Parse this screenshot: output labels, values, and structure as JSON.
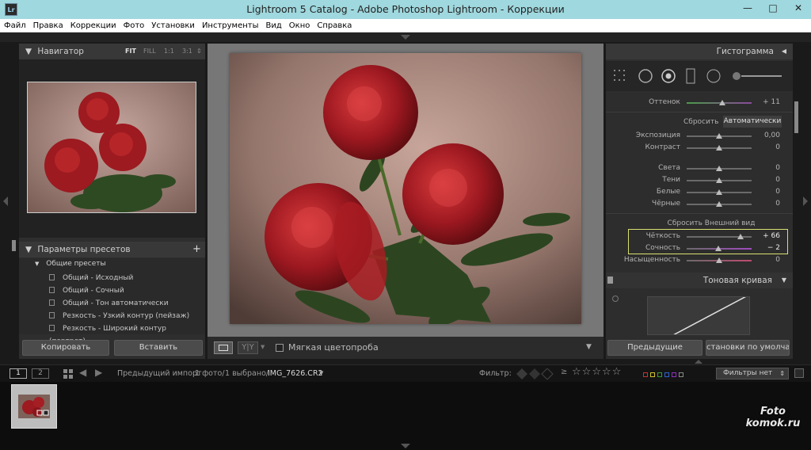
{
  "window": {
    "title": "Lightroom 5 Catalog - Adobe Photoshop Lightroom - Коррекции",
    "app_icon_text": "Lr",
    "minimize": "—",
    "maximize": "□",
    "close": "✕"
  },
  "menu": [
    "Файл",
    "Правка",
    "Коррекции",
    "Фото",
    "Установки",
    "Инструменты",
    "Вид",
    "Окно",
    "Справка"
  ],
  "navigator": {
    "title": "Навигатор",
    "zoom_options": [
      "FIT",
      "FILL",
      "1:1",
      "3:1"
    ]
  },
  "presets": {
    "title": "Параметры пресетов",
    "add_label": "+",
    "group": "Общие пресеты",
    "items": [
      "Общий - Исходный",
      "Общий - Сочный",
      "Общий - Тон автоматически",
      "Резкость - Узкий контур (пейзаж)",
      "Резкость - Широкий контур (портрет)"
    ]
  },
  "left_buttons": {
    "copy": "Копировать",
    "paste": "Вставить"
  },
  "center_toolbar": {
    "soft_proof_label": "Мягкая цветопроба",
    "view_yy": "Y|Y"
  },
  "right_panel": {
    "histogram_title": "Гистограмма",
    "tint": {
      "label": "Оттенок",
      "value": "+ 11",
      "position": 0.55
    },
    "tone_reset": "Сбросить",
    "tone_auto": "Автоматически",
    "tone_sliders": [
      {
        "label": "Экспозиция",
        "value": "0,00",
        "position": 0.5
      },
      {
        "label": "Контраст",
        "value": "0",
        "position": 0.5
      }
    ],
    "light_sliders": [
      {
        "label": "Света",
        "value": "0",
        "position": 0.5
      },
      {
        "label": "Тени",
        "value": "0",
        "position": 0.5
      },
      {
        "label": "Белые",
        "value": "0",
        "position": 0.5
      },
      {
        "label": "Чёрные",
        "value": "0",
        "position": 0.5
      }
    ],
    "presence_reset": "Сбросить Внешний вид",
    "presence_sliders": [
      {
        "label": "Чёткость",
        "value": "+ 66",
        "position": 0.83,
        "highlight": true
      },
      {
        "label": "Сочность",
        "value": "− 2",
        "position": 0.49,
        "highlight": true
      },
      {
        "label": "Насыщенность",
        "value": "0",
        "position": 0.5,
        "highlight": false
      }
    ],
    "tone_curve_title": "Тоновая кривая",
    "previous_button": "Предыдущие",
    "defaults_button": "становки по умолчанию..."
  },
  "filmstrip": {
    "page1": "1",
    "page2": "2",
    "source": "Предыдущий импорт",
    "count": "1 фото/",
    "selected": "1 выбрано/",
    "filename": "IMG_7626.CR2",
    "filter_label": "Фильтр:",
    "filter_value": "Фильтры нет",
    "color_labels": [
      "#d03030",
      "#d0c030",
      "#30a030",
      "#3060d0",
      "#9030c0",
      "#888888"
    ]
  },
  "watermark": {
    "line1": "Foto",
    "line2": "komok.ru"
  },
  "colors": {
    "highlight_box": "#d8e070",
    "clarity_track_gradient": "#7a7a7a"
  }
}
